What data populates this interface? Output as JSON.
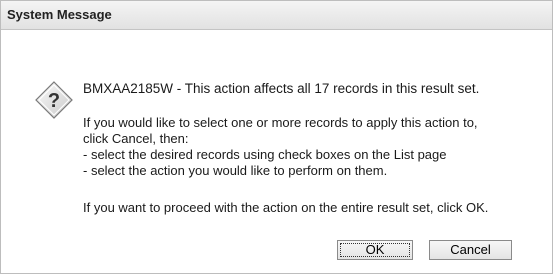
{
  "dialog": {
    "title": "System Message",
    "icon": "question-diamond-icon",
    "message_main": "BMXAA2185W - This action affects all 17 records in this result set.",
    "para1_line1": "If you would like to select one or more records to apply this action to,",
    "para1_line2": "click Cancel, then:",
    "para1_line3": "- select the desired records using check boxes on the List page",
    "para1_line4": "- select the action you would like to perform on them.",
    "para2": "If you want to proceed with the action on the entire result set, click OK.",
    "ok_label": "OK",
    "cancel_label": "Cancel"
  }
}
